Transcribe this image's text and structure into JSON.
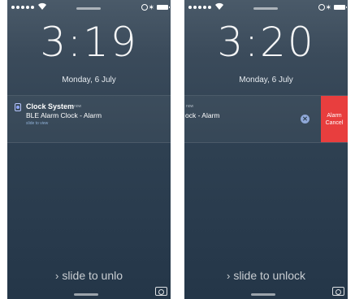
{
  "screens": [
    {
      "time": "3:19",
      "date": "Monday, 6 July",
      "notification": {
        "title": "Clock System",
        "time_label": "now",
        "body": "BLE Alarm Clock - Alarm",
        "hint": "slide to view"
      },
      "slide_text": "slide to unlo",
      "slide_icon": "chevron-right-icon"
    },
    {
      "time": "3:20",
      "date": "Monday, 6 July",
      "notification": {
        "time_label": "now",
        "body": "ock - Alarm",
        "clear_icon": "close-icon",
        "action_label": "Alarm Cancel"
      },
      "slide_text": "slide to unlock",
      "slide_icon": "chevron-right-icon"
    }
  ],
  "colors": {
    "background_top": "#4a5a69",
    "background_bottom": "#243648",
    "action_red": "#e83e3e",
    "clear_blue": "#8fa8d8"
  }
}
